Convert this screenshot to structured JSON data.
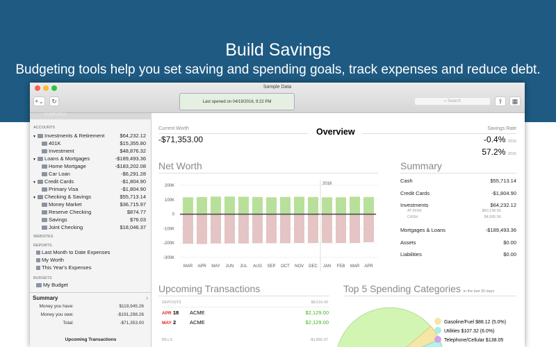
{
  "banner": {
    "title": "Build Savings",
    "subtitle": "Budgeting tools help you set saving and spending goals, track expenses and reduce debt."
  },
  "window": {
    "title": "Sample Data",
    "add_label": "+⌄",
    "refresh_label": "↻",
    "last_opened": "Last opened on 04/19/2016, 9:22 PM",
    "search_placeholder": "Search"
  },
  "sidebar": {
    "overview": "OVERVIEW",
    "accounts_header": "ACCOUNTS",
    "accounts": [
      {
        "name": "Investments & Retirement",
        "value": "$64,232.12",
        "group": true
      },
      {
        "name": "401K",
        "value": "$15,355.80"
      },
      {
        "name": "Investment",
        "value": "$48,876.32"
      },
      {
        "name": "Loans & Mortgages",
        "value": "-$189,493.36",
        "group": true
      },
      {
        "name": "Home Mortgage",
        "value": "-$183,202.08"
      },
      {
        "name": "Car  Loan",
        "value": "-$6,291.28"
      },
      {
        "name": "Credit Cards",
        "value": "-$1,804.90",
        "group": true
      },
      {
        "name": "Primary Visa",
        "value": "-$1,804.90"
      },
      {
        "name": "Checking & Savings",
        "value": "$55,713.14",
        "group": true
      },
      {
        "name": "Money Market",
        "value": "$36,715.97"
      },
      {
        "name": "Reserve Checking",
        "value": "$874.77"
      },
      {
        "name": "Savings",
        "value": "$76.03"
      },
      {
        "name": "Joint Checking",
        "value": "$18,046.37"
      }
    ],
    "websites_header": "WEBSITES",
    "reports_header": "REPORTS",
    "reports": [
      "Last Month to Date Expenses",
      "My Worth",
      "This Year's Expenses"
    ],
    "budgets_header": "BUDGETS",
    "budgets": [
      "My Budget"
    ],
    "summary": {
      "title": "Summary",
      "have_label": "Money you have:",
      "have": "$119,945.26",
      "owe_label": "Money you owe:",
      "owe": "-$191,298.26",
      "total_label": "Total:",
      "total": "-$71,353.00"
    },
    "upcoming_title": "Upcoming Transactions"
  },
  "overview": {
    "title": "Overview",
    "current_worth_label": "Current Worth",
    "current_worth": "-$71,353.00",
    "savings_rate_label": "Savings Rate",
    "rates": [
      {
        "value": "-0.4%",
        "year": "2016"
      },
      {
        "value": "57.2%",
        "year": "2015"
      }
    ]
  },
  "net_worth": {
    "title": "Net Worth"
  },
  "chart_data": {
    "type": "bar",
    "categories": [
      "MAR",
      "APR",
      "MAY",
      "JUN",
      "JUL",
      "AUG",
      "SEP",
      "OCT",
      "NOV",
      "DEC",
      "JAN",
      "FEB",
      "MAR",
      "APR"
    ],
    "series": [
      {
        "values": [
          117000,
          119000,
          122000,
          122000,
          121000,
          119000,
          117000,
          119000,
          121000,
          119000,
          117000,
          117000,
          121000,
          119000
        ],
        "color": "#b9e09a"
      },
      {
        "values": [
          -205000,
          -207000,
          -203000,
          -203000,
          -203000,
          -201000,
          -201000,
          -201000,
          -199000,
          -199000,
          -199000,
          -199000,
          -199000,
          -194000
        ],
        "color": "#e4c4c4"
      }
    ],
    "yticks": [
      "200K",
      "100K",
      "0",
      "-100K",
      "-200K",
      "-300K"
    ],
    "ylim": [
      -300000,
      200000
    ],
    "annotation": "2016",
    "grid": true
  },
  "summary": {
    "title": "Summary",
    "rows": [
      {
        "label": "Cash",
        "value": "$55,713.14"
      },
      {
        "label": "Credit Cards",
        "value": "-$1,804.90"
      },
      {
        "label": "Investments",
        "value": "$64,232.12",
        "sub": [
          {
            "label": "AT RISK",
            "value": "$60,136.56"
          },
          {
            "label": "CASH",
            "value": "$4,095.56"
          }
        ]
      },
      {
        "label": "Mortgages & Loans",
        "value": "-$189,493.36"
      },
      {
        "label": "Assets",
        "value": "$0.00"
      },
      {
        "label": "Liabilities",
        "value": "$0.00"
      }
    ]
  },
  "upcoming": {
    "title": "Upcoming Transactions",
    "deposits_label": "DEPOSITS",
    "deposits_total": "$8,516.00",
    "deposits": [
      {
        "month": "APR",
        "day": "18",
        "payee": "ACME",
        "amount": "$2,129.00"
      },
      {
        "month": "MAY",
        "day": "2",
        "payee": "ACME",
        "amount": "$2,129.00"
      }
    ],
    "bills_label": "BILLS",
    "bills_total": "-$1,850.37"
  },
  "spending": {
    "title": "Top 5 Spending Categories",
    "subtitle": "in the last 30 days",
    "legend": [
      {
        "label": "Gasoline/Fuel $88.12 (5.0%)",
        "color": "#f6e6a6"
      },
      {
        "label": "Utilities $107.32 (6.0%)",
        "color": "#a6f0e0"
      },
      {
        "label": "Telephone/Cellular $138.05",
        "color": "#d6a0ea"
      }
    ]
  }
}
